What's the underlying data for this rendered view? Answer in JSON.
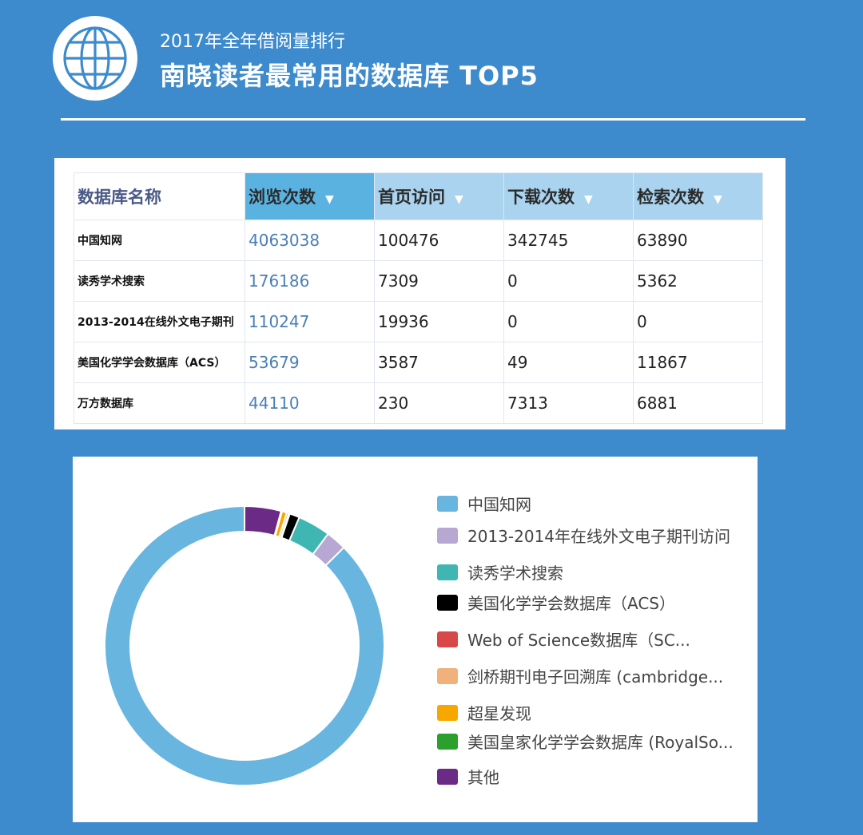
{
  "header": {
    "subtitle": "2017年全年借阅量排行",
    "title": "南晓读者最常用的数据库 TOP5"
  },
  "table": {
    "columns": [
      "数据库名称",
      "浏览次数",
      "首页访问",
      "下载次数",
      "检索次数"
    ],
    "rows": [
      [
        "中国知网",
        "4063038",
        "100476",
        "342745",
        "63890"
      ],
      [
        "读秀学术搜索",
        "176186",
        "7309",
        "0",
        "5362"
      ],
      [
        "2013-2014在线外文电子期刊",
        "110247",
        "19936",
        "0",
        "0"
      ],
      [
        "美国化学学会数据库（ACS）",
        "53679",
        "3587",
        "49",
        "11867"
      ],
      [
        "万方数据库",
        "44110",
        "230",
        "7313",
        "6881"
      ]
    ]
  },
  "chart_data": {
    "type": "pie",
    "donut": true,
    "legend_position": "right",
    "slices": [
      {
        "label": "中国知网",
        "value": 4063038,
        "color": "#68b6e0"
      },
      {
        "label": "2013-2014年在线外文电子期刊访问",
        "value": 110247,
        "color": "#b6a7d3"
      },
      {
        "label": "读秀学术搜索",
        "value": 176186,
        "color": "#3fb6b2"
      },
      {
        "label": "美国化学学会数据库（ACS）",
        "value": 53679,
        "color": "#000000"
      },
      {
        "label": "Web of Science数据库（SC...",
        "value": 5000,
        "color": "#d94848"
      },
      {
        "label": "剑桥期刊电子回溯库 (cambridge...",
        "value": 12000,
        "color": "#f0b27a"
      },
      {
        "label": "超星发现",
        "value": 26000,
        "color": "#f6a800"
      },
      {
        "label": "美国皇家化学学会数据库 (RoyalSo...",
        "value": 5000,
        "color": "#2ca02c"
      },
      {
        "label": "其他",
        "value": 196000,
        "color": "#6a2a85"
      }
    ]
  }
}
